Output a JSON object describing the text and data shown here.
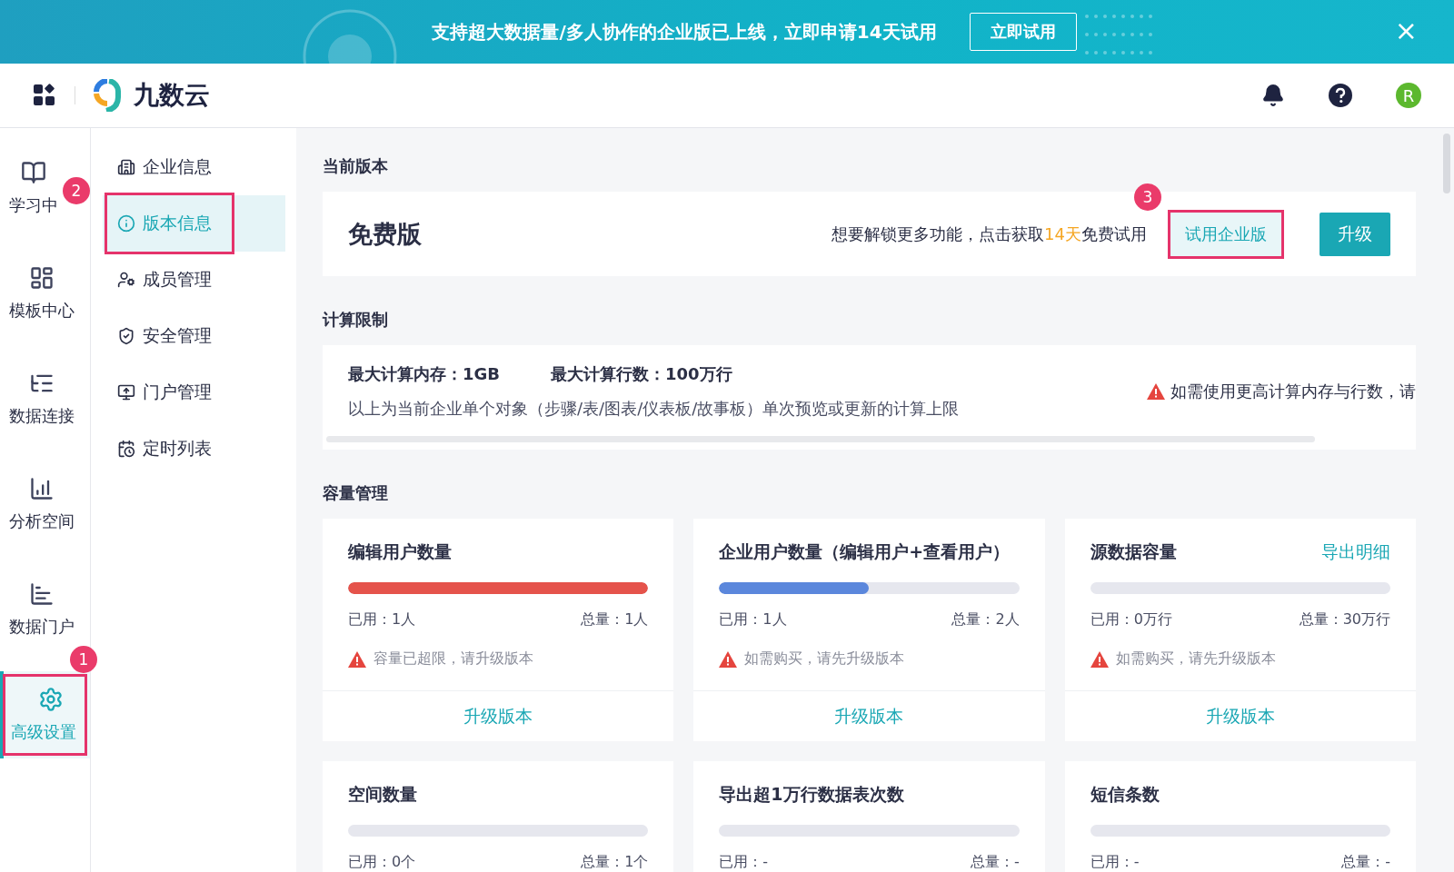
{
  "banner": {
    "message": "支持超大数据量/多人协作的企业版已上线，立即申请14天试用",
    "button": "立即试用",
    "close": "×"
  },
  "header": {
    "brand": "九数云",
    "avatar": "R"
  },
  "rail": [
    {
      "label": "学习中",
      "selected": false
    },
    {
      "label": "模板中心",
      "selected": false
    },
    {
      "label": "数据连接",
      "selected": false
    },
    {
      "label": "分析空间",
      "selected": false
    },
    {
      "label": "数据门户",
      "selected": false
    },
    {
      "label": "高级设置",
      "selected": true,
      "callout": "1"
    }
  ],
  "submenu": [
    {
      "label": "企业信息",
      "selected": false
    },
    {
      "label": "版本信息",
      "selected": true,
      "callout": "2"
    },
    {
      "label": "成员管理",
      "selected": false
    },
    {
      "label": "安全管理",
      "selected": false
    },
    {
      "label": "门户管理",
      "selected": false
    },
    {
      "label": "定时列表",
      "selected": false
    }
  ],
  "version": {
    "title": "当前版本",
    "plan": "免费版",
    "promo_before": "想要解锁更多功能，点击获取",
    "promo_highlight": "14天",
    "promo_after": "免费试用",
    "trial_button": {
      "label": "试用企业版",
      "callout": "3"
    },
    "upgrade_button": "升级"
  },
  "compute": {
    "title": "计算限制",
    "memory": "最大计算内存：1GB",
    "rows": "最大计算行数：100万行",
    "description": "以上为当前企业单个对象（步骤/表/图表/仪表板/故事板）单次预览或更新的计算上限",
    "warning": "如需使用更高计算内存与行数，请"
  },
  "capacity": {
    "title": "容量管理",
    "cards": [
      {
        "title": "编辑用户数量",
        "level": 1,
        "color": "#e5534b",
        "used": "已用：1人",
        "total": "总量：1人",
        "warning": "容量已超限，请升级版本",
        "action": "升级版本"
      },
      {
        "title": "企业用户数量（编辑用户+查看用户）",
        "level": 0.5,
        "color": "#5b87dc",
        "used": "已用：1人",
        "total": "总量：2人",
        "warning": "如需购买，请先升级版本",
        "action": "升级版本"
      },
      {
        "title": "源数据容量",
        "link": "导出明细",
        "level": 0,
        "used": "已用：0万行",
        "total": "总量：30万行",
        "warning": "如需购买，请先升级版本",
        "action": "升级版本"
      },
      {
        "title": "空间数量",
        "level": 0,
        "used": "已用：0个",
        "total": "总量：1个"
      },
      {
        "title": "导出超1万行数据表次数",
        "level": 0,
        "used": "已用：-",
        "total": "总量：-"
      },
      {
        "title": "短信条数",
        "level": 0,
        "used": "已用：-",
        "total": "总量：-"
      }
    ]
  }
}
